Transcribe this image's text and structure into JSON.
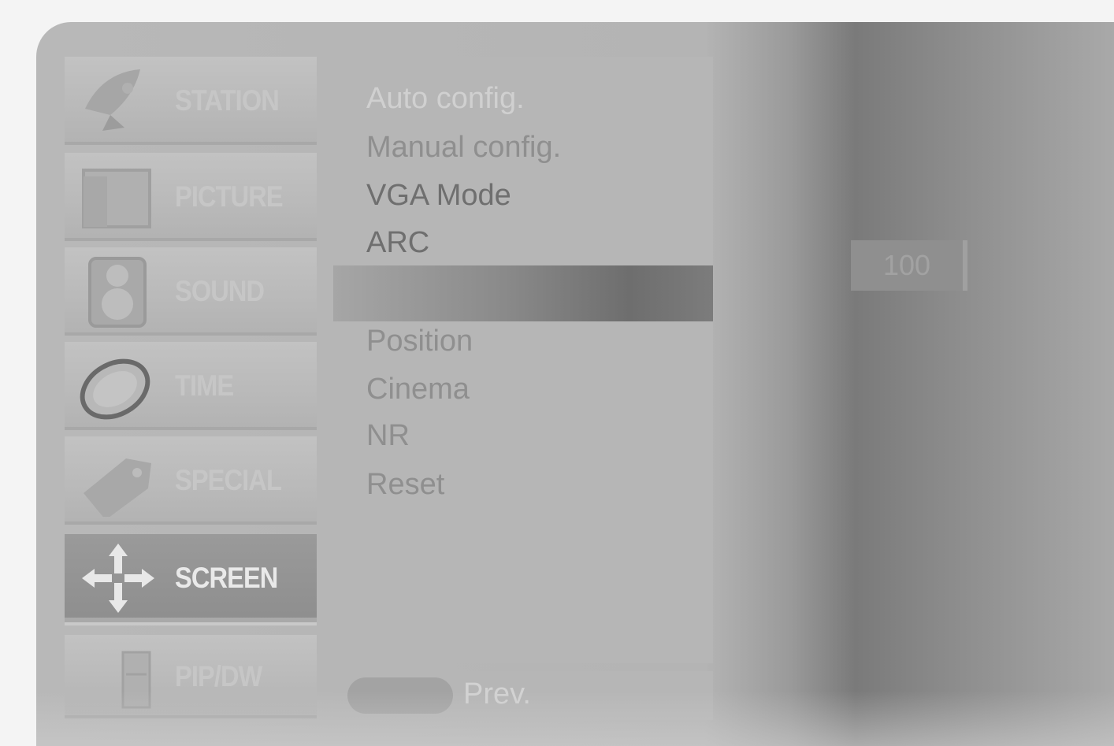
{
  "main_menu": {
    "items": [
      {
        "label": "STATION",
        "icon": "satellite-dish-icon",
        "active": false
      },
      {
        "label": "PICTURE",
        "icon": "picture-icon",
        "active": false
      },
      {
        "label": "SOUND",
        "icon": "speaker-icon",
        "active": false
      },
      {
        "label": "TIME",
        "icon": "clock-icon",
        "active": false
      },
      {
        "label": "SPECIAL",
        "icon": "tag-icon",
        "active": false
      },
      {
        "label": "SCREEN",
        "icon": "move-arrows-icon",
        "active": true
      },
      {
        "label": "PIP/DW",
        "icon": "pip-icon",
        "active": false
      }
    ]
  },
  "screen_menu": {
    "group1": [
      "Auto config.",
      "Manual config.",
      "VGA Mode",
      "ARC"
    ],
    "group2": [
      "Position",
      "Cinema",
      "NR",
      "Reset"
    ]
  },
  "navigation": {
    "prev_label": "Prev."
  },
  "value_display": "100",
  "colors": {
    "active_tile": "#8e8e8e",
    "panel": "#b6b6b6",
    "text_light": "#d0d0d0"
  }
}
